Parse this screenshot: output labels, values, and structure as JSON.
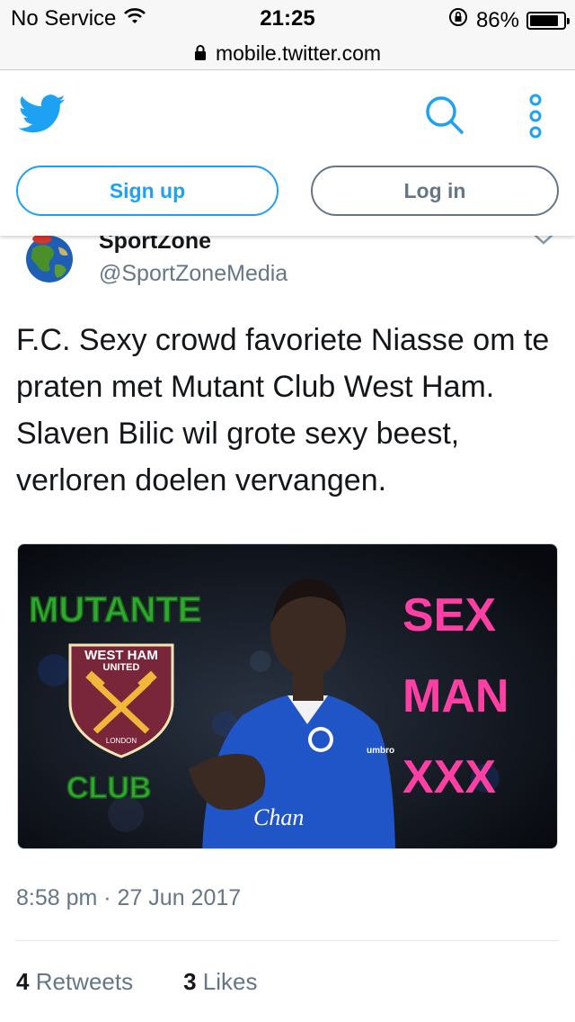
{
  "status_bar": {
    "carrier": "No Service",
    "time": "21:25",
    "battery": "86%",
    "battery_level": 0.86
  },
  "browser": {
    "url": "mobile.twitter.com"
  },
  "header": {
    "signup_label": "Sign up",
    "login_label": "Log in"
  },
  "tweet": {
    "display_name": "SportZone",
    "handle": "@SportZoneMedia",
    "text": "F.C. Sexy crowd favoriete Niasse om te praten met Mutant Club West Ham. Slaven Bilic wil grote sexy beest, verloren doelen vervangen.",
    "media": {
      "left_top_text": "MUTANTE",
      "left_bottom_text": "CLUB",
      "crest_top": "WEST HAM",
      "crest_sub": "UNITED",
      "crest_bottom": "LONDON",
      "right_texts": [
        "SEX",
        "MAN",
        "XXX"
      ],
      "shirt_text": "Chan",
      "shirt_brand": "umbro"
    },
    "timestamp": "8:58 pm · 27 Jun 2017",
    "retweets_count": "4",
    "retweets_label": "Retweets",
    "likes_count": "3",
    "likes_label": "Likes"
  },
  "colors": {
    "twitter_blue": "#1da1f2",
    "gray": "#657786",
    "green_text": "#2fa82f",
    "pink_text": "#ff3fa4",
    "claret": "#7a263a"
  },
  "icons": [
    "wifi-icon",
    "lock-icon",
    "rotation-lock-icon",
    "battery-icon",
    "twitter-bird-icon",
    "search-icon",
    "more-vertical-icon",
    "chevron-down-icon"
  ]
}
